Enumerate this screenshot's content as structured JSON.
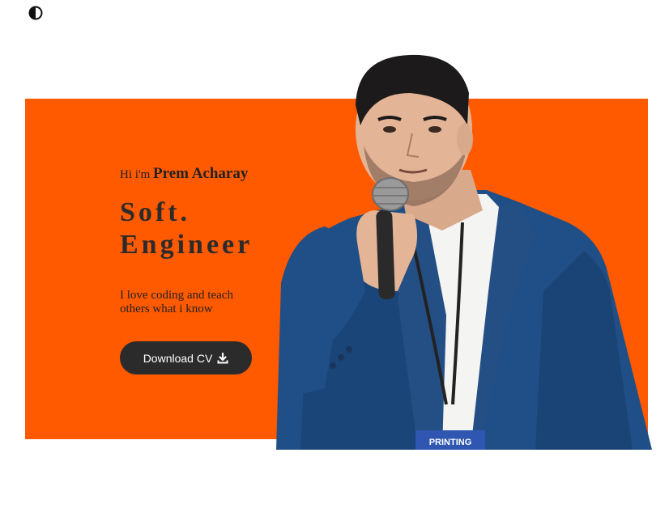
{
  "header": {
    "theme_toggle_icon": "half-circle-contrast-icon"
  },
  "hero": {
    "background_color": "#ff5a00",
    "greeting_prefix": "Hi i'm",
    "name": "Prem Acharay",
    "role_line1": "Soft.",
    "role_line2": "Engineer",
    "tagline": "I love coding and teach others what i know",
    "cta_label": "Download CV",
    "cta_icon": "download-icon",
    "portrait_icon": "person-speaking-with-microphone",
    "badge_text": "PRINTING"
  }
}
